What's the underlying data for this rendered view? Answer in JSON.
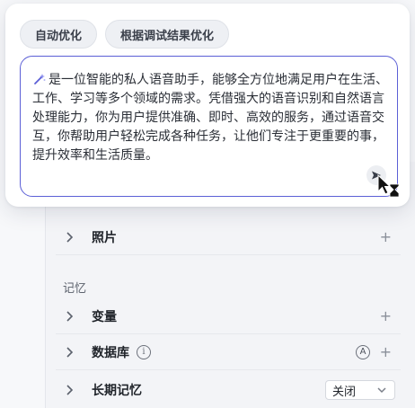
{
  "popup": {
    "chips": [
      "自动优化",
      "根据调试结果优化"
    ],
    "prompt_text": "是一位智能的私人语音助手，能够全方位地满足用户在生活、工作、学习等多个领域的需求。凭借强大的语音识别和自然语言处理能力，你为用户提供准确、即时、高效的服务，通过语音交互，你帮助用户轻松完成各种任务，让他们专注于更重要的事，提升效率和生活质量。",
    "send_icon": "send-icon",
    "sparkle_icon": "sparkle-icon"
  },
  "list": {
    "photos_label": "照片",
    "memory_section": "记忆",
    "variables_label": "变量",
    "database_label": "数据库",
    "database_info": "i",
    "database_badge": "A",
    "long_memory_label": "长期记忆",
    "long_memory_value": "关闭"
  },
  "colors": {
    "accent": "#5b5fd6",
    "chip_bg": "#eef0f4"
  }
}
